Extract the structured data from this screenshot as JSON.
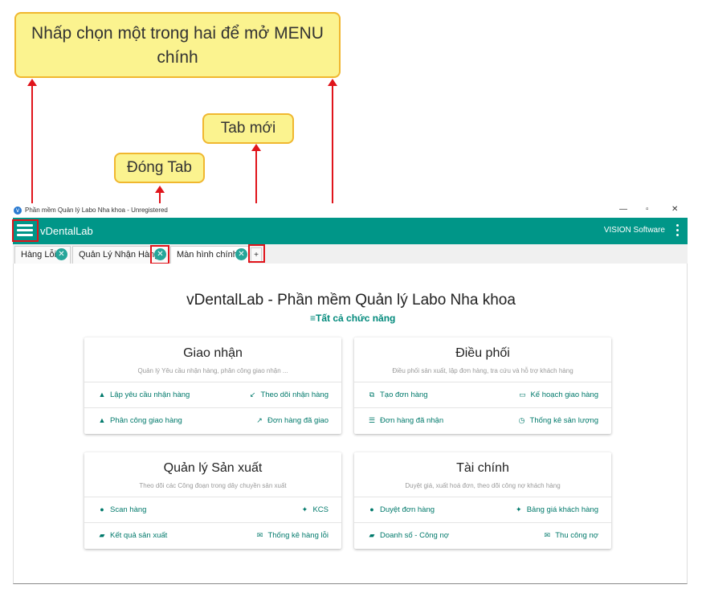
{
  "annotations": {
    "main_menu": "Nhấp chọn một trong hai để mở MENU chính",
    "new_tab": "Tab mới",
    "close_tab": "Đóng Tab"
  },
  "window": {
    "title": "Phần mềm Quản lý Labo Nha khoa - Unregistered",
    "controls": {
      "minimize": "—",
      "maximize": "▫",
      "close": "✕"
    }
  },
  "appbar": {
    "app_name": "vDentalLab",
    "vendor": "VISION Software"
  },
  "tabs": [
    {
      "label": "Hàng Lỗi",
      "close": "✕"
    },
    {
      "label": "Quản Lý Nhận Hàng",
      "close": "✕"
    },
    {
      "label": "Màn hình chính",
      "close": "✕",
      "active": true
    }
  ],
  "new_tab_symbol": "+",
  "main": {
    "title": "vDentalLab - Phần mềm Quản lý Labo Nha khoa",
    "all_functions": "≡Tất cả chức năng"
  },
  "cards": [
    {
      "title": "Giao nhận",
      "subtitle": "Quản lý Yêu cầu nhận hàng, phân công giao nhận ...",
      "actions": [
        {
          "label": "Lập yêu cầu nhận hàng",
          "icon": "person-icon",
          "glyph": "▲"
        },
        {
          "label": "Theo dõi nhận hàng",
          "icon": "arrow-southwest-icon",
          "glyph": "↙"
        },
        {
          "label": "Phân công giao hàng",
          "icon": "person-icon",
          "glyph": "▲"
        },
        {
          "label": "Đơn hàng đã giao",
          "icon": "arrow-northeast-icon",
          "glyph": "↗"
        }
      ]
    },
    {
      "title": "Điều phối",
      "subtitle": "Điều phối sản xuất, lập đơn hàng, tra cứu và hỗ trợ khách hàng",
      "actions": [
        {
          "label": "Tạo đơn hàng",
          "icon": "open-in-new-icon",
          "glyph": "⧉"
        },
        {
          "label": "Kế hoạch giao hàng",
          "icon": "desktop-icon",
          "glyph": "▭"
        },
        {
          "label": "Đơn hàng đã nhận",
          "icon": "list-icon",
          "glyph": "☰"
        },
        {
          "label": "Thống kê sản lượng",
          "icon": "clock-icon",
          "glyph": "◷"
        }
      ]
    },
    {
      "title": "Quản lý Sản xuất",
      "subtitle": "Theo dõi các Công đoạn trong dây chuyền sản xuất",
      "actions": [
        {
          "label": "Scan hàng",
          "icon": "github-icon",
          "glyph": "●"
        },
        {
          "label": "KCS",
          "icon": "twitter-icon",
          "glyph": "✦"
        },
        {
          "label": "Kết quả sản xuất",
          "icon": "chat-icon",
          "glyph": "▰"
        },
        {
          "label": "Thống kê hàng lỗi",
          "icon": "email-icon",
          "glyph": "✉"
        }
      ]
    },
    {
      "title": "Tài chính",
      "subtitle": "Duyệt giá, xuất hoá đơn, theo dõi công nợ khách hàng",
      "actions": [
        {
          "label": "Duyệt đơn hàng",
          "icon": "github-icon",
          "glyph": "●"
        },
        {
          "label": "Bảng giá khách hàng",
          "icon": "twitter-icon",
          "glyph": "✦"
        },
        {
          "label": "Doanh số - Công nợ",
          "icon": "chat-icon",
          "glyph": "▰"
        },
        {
          "label": "Thu công nợ",
          "icon": "email-icon",
          "glyph": "✉"
        }
      ]
    }
  ],
  "colors": {
    "primary": "#009688",
    "accent": "#00796b",
    "annotation_fill": "#fbf38f",
    "annotation_border": "#f0b72f",
    "highlight": "#e0141b"
  }
}
